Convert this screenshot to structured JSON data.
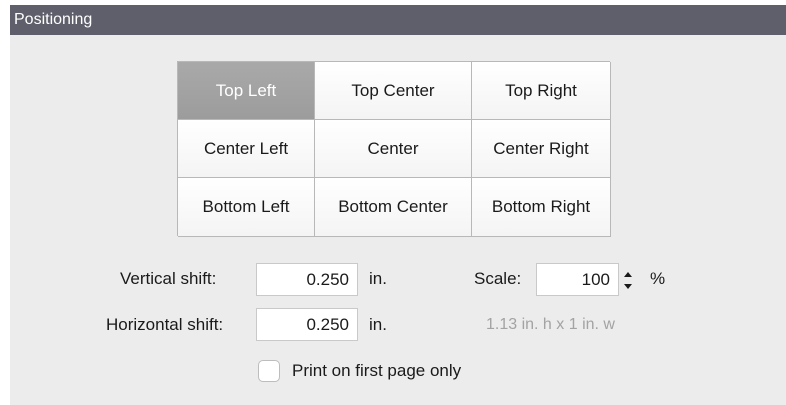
{
  "panel": {
    "title": "Positioning"
  },
  "position_grid": {
    "selected": "Top Left",
    "cells": [
      {
        "label": "Top Left"
      },
      {
        "label": "Top Center"
      },
      {
        "label": "Top Right"
      },
      {
        "label": "Center Left"
      },
      {
        "label": "Center"
      },
      {
        "label": "Center Right"
      },
      {
        "label": "Bottom Left"
      },
      {
        "label": "Bottom Center"
      },
      {
        "label": "Bottom Right"
      }
    ]
  },
  "vertical_shift": {
    "label": "Vertical shift:",
    "value": "0.250",
    "unit": "in."
  },
  "horizontal_shift": {
    "label": "Horizontal shift:",
    "value": "0.250",
    "unit": "in."
  },
  "scale": {
    "label": "Scale:",
    "value": "100",
    "unit": "%"
  },
  "size_hint": "1.13 in. h x 1 in. w",
  "first_page_only": {
    "label": "Print on first page only",
    "checked": false
  },
  "icons": {
    "stepper_up": "chevron-up-icon",
    "stepper_down": "chevron-down-icon"
  },
  "colors": {
    "header_bg": "#5e5f6b",
    "panel_bg": "#ececec",
    "selected_cell_bg": "#a3a3a3",
    "hint_text": "#a3a3a3"
  }
}
